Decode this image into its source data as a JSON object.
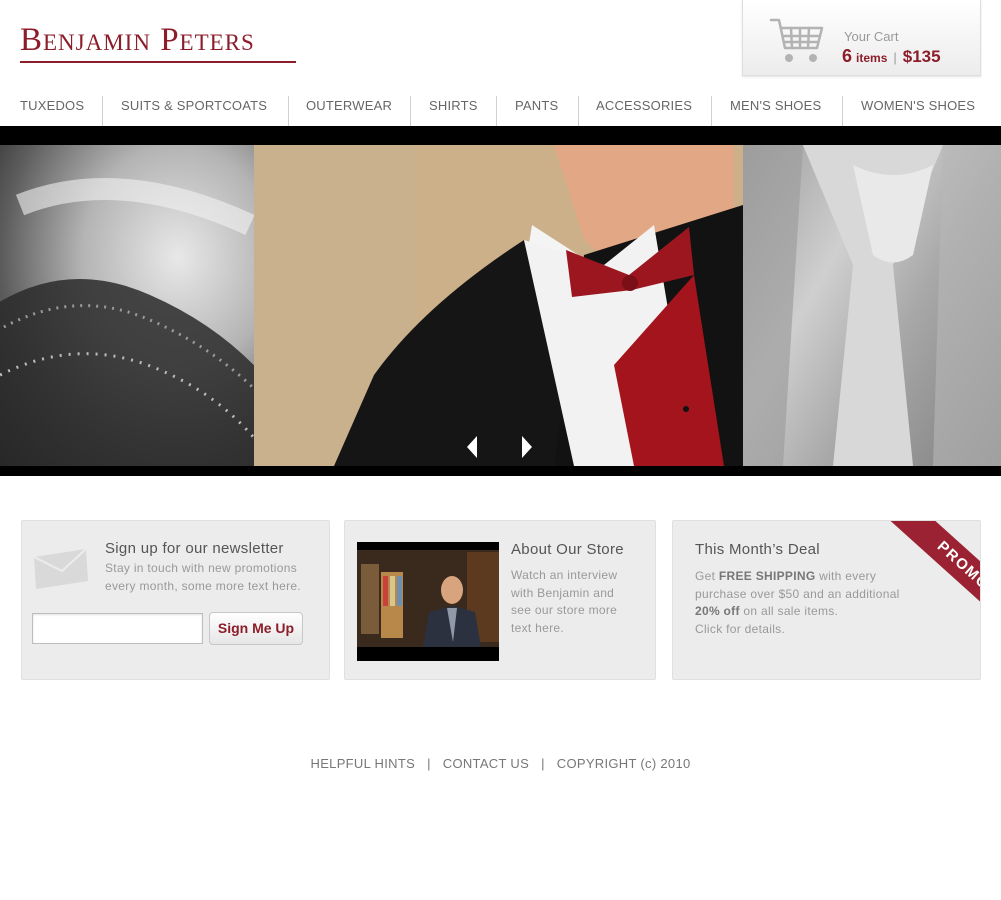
{
  "header": {
    "logo_text": "Benjamin Peters"
  },
  "cart": {
    "label": "Your Cart",
    "count": "6",
    "items_label": "items",
    "separator": "|",
    "total": "$135",
    "icon": "shopping-cart-icon"
  },
  "nav": {
    "items": [
      {
        "label": "TUXEDOS"
      },
      {
        "label": "SUITS & SPORTCOATS"
      },
      {
        "label": "OUTERWEAR"
      },
      {
        "label": "SHIRTS"
      },
      {
        "label": "PANTS"
      },
      {
        "label": "ACCESSORIES"
      },
      {
        "label": "MEN'S SHOES"
      },
      {
        "label": "WOMEN'S SHOES"
      }
    ]
  },
  "slideshow": {
    "prev_icon": "arrow-left-icon",
    "next_icon": "arrow-right-icon"
  },
  "newsletter": {
    "title": "Sign up for our newsletter",
    "text": "Stay in touch with new promotions every month, some more text here.",
    "email_value": "",
    "button_label": "Sign Me Up",
    "icon": "envelope-icon"
  },
  "about": {
    "title": "About Our Store",
    "text": "Watch an interview with Benjamin and see our store more text here."
  },
  "deal": {
    "title": "This Month’s Deal",
    "text_before": "Get ",
    "bold1": "FREE SHIPPING",
    "text_mid": " with every purchase over $50 and an additional ",
    "bold2": "20% off",
    "text_after": " on all sale items.",
    "cta": "Click for details.",
    "ribbon": "PROMO"
  },
  "footer": {
    "links": [
      "HELPFUL HINTS",
      "CONTACT US",
      "COPYRIGHT (c) 2010"
    ],
    "separator": "|"
  },
  "colors": {
    "brand": "#8c1d2a",
    "panel": "#ececec",
    "text": "#666666"
  }
}
